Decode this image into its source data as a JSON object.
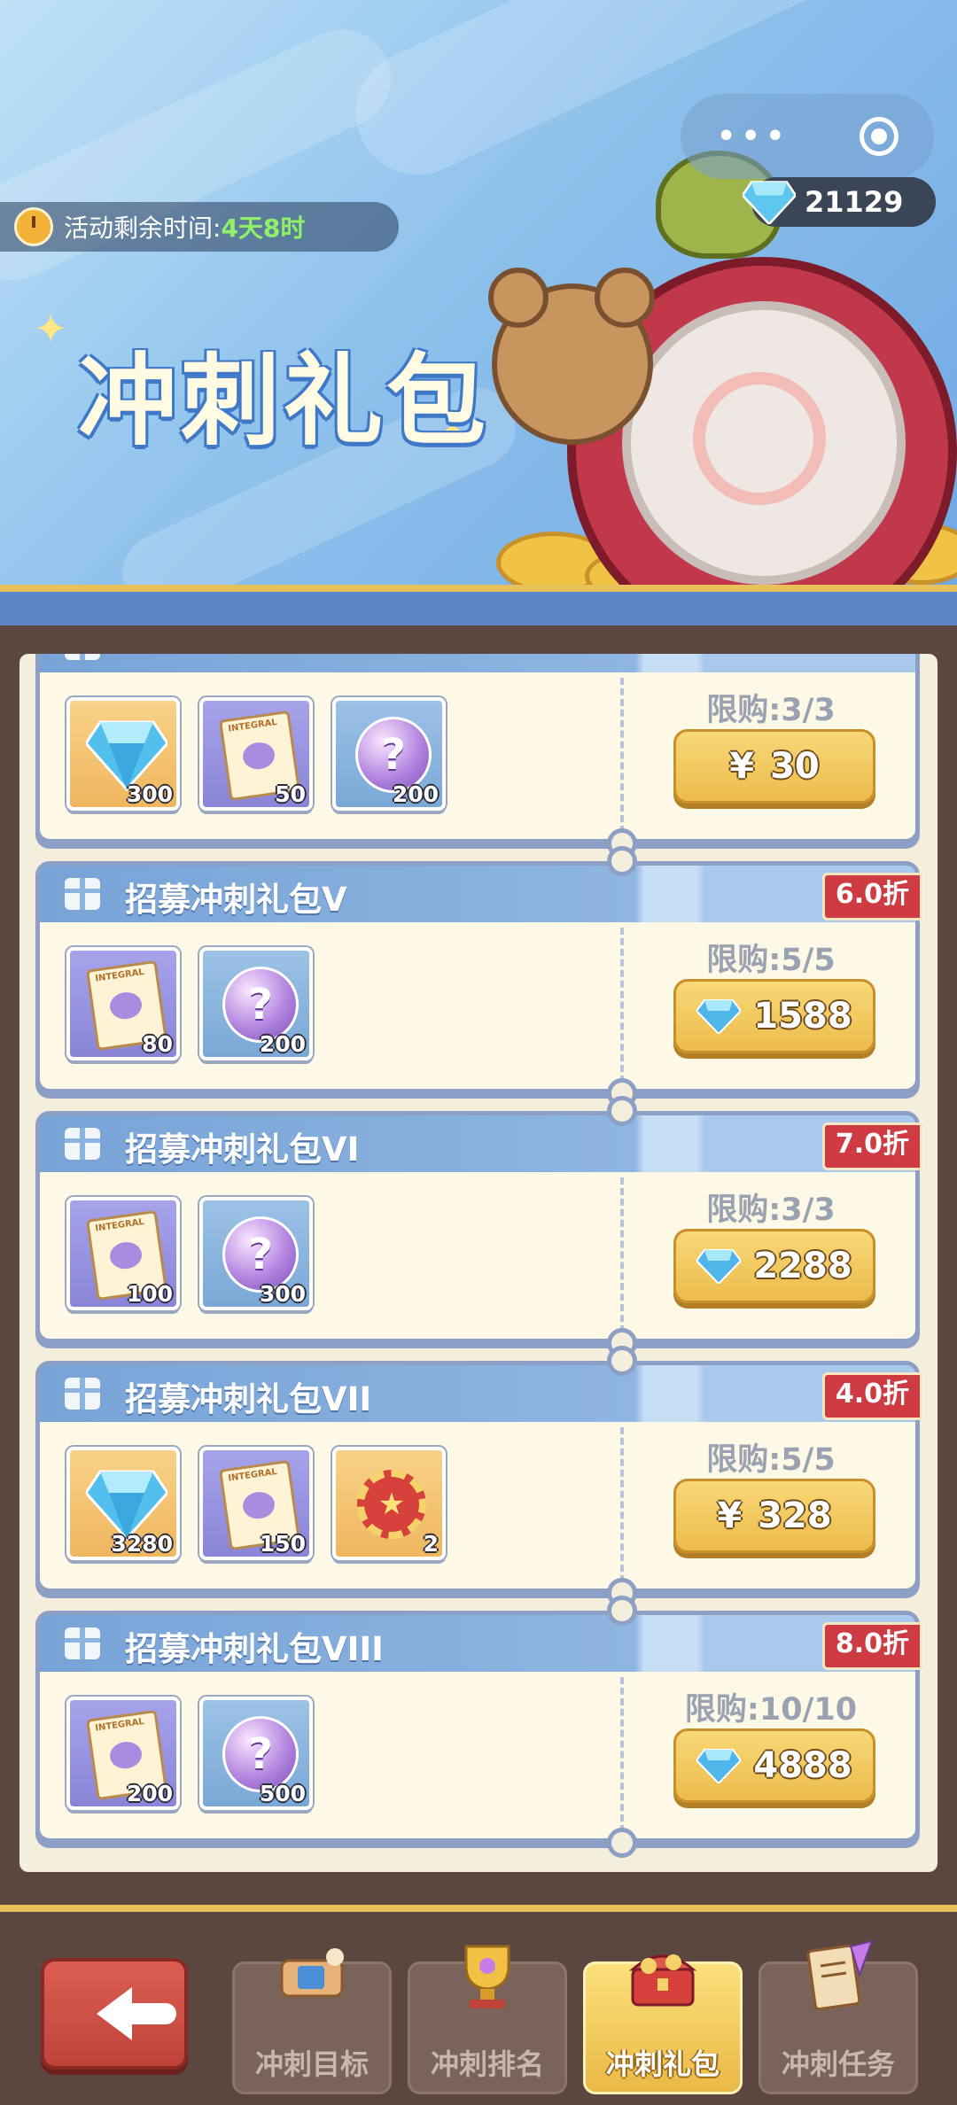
{
  "header": {
    "timer_label": "活动剩余时间:",
    "timer_value": "4天8时",
    "title": "冲刺礼包",
    "gem_balance": "21129"
  },
  "packs": [
    {
      "title": "",
      "discount": "",
      "limit": "限购:3/3",
      "price_type": "yen",
      "price_symbol": "¥",
      "price": "30",
      "items": [
        {
          "icon": "diamond-icon",
          "qty": "300"
        },
        {
          "icon": "integral-scroll-icon",
          "qty": "50"
        },
        {
          "icon": "mystery-orb-icon",
          "qty": "200"
        }
      ]
    },
    {
      "title": "招募冲刺礼包V",
      "discount": "6.0折",
      "limit": "限购:5/5",
      "price_type": "gem",
      "price": "1588",
      "items": [
        {
          "icon": "integral-scroll-icon",
          "qty": "80"
        },
        {
          "icon": "mystery-orb-icon",
          "qty": "200"
        }
      ]
    },
    {
      "title": "招募冲刺礼包VI",
      "discount": "7.0折",
      "limit": "限购:3/3",
      "price_type": "gem",
      "price": "2288",
      "items": [
        {
          "icon": "integral-scroll-icon",
          "qty": "100"
        },
        {
          "icon": "mystery-orb-icon",
          "qty": "300"
        }
      ]
    },
    {
      "title": "招募冲刺礼包VII",
      "discount": "4.0折",
      "limit": "限购:5/5",
      "price_type": "yen",
      "price_symbol": "¥",
      "price": "328",
      "items": [
        {
          "icon": "diamond-icon",
          "qty": "3280"
        },
        {
          "icon": "integral-scroll-icon",
          "qty": "150"
        },
        {
          "icon": "chip-token-icon",
          "qty": "2"
        }
      ]
    },
    {
      "title": "招募冲刺礼包VIII",
      "discount": "8.0折",
      "limit": "限购:10/10",
      "price_type": "gem",
      "price": "4888",
      "items": [
        {
          "icon": "integral-scroll-icon",
          "qty": "200"
        },
        {
          "icon": "mystery-orb-icon",
          "qty": "500"
        }
      ]
    }
  ],
  "nav": {
    "tabs": [
      {
        "label": "冲刺目标",
        "icon": "scroll-map-icon",
        "active": false
      },
      {
        "label": "冲刺排名",
        "icon": "trophy-icon",
        "active": false
      },
      {
        "label": "冲刺礼包",
        "icon": "treasure-chest-icon",
        "active": true
      },
      {
        "label": "冲刺任务",
        "icon": "quest-scroll-icon",
        "active": false
      }
    ]
  },
  "colors": {
    "accent_gold": "#ecbc4b",
    "discount_red": "#cf3b42",
    "card_header_blue": "#78a3d6"
  }
}
